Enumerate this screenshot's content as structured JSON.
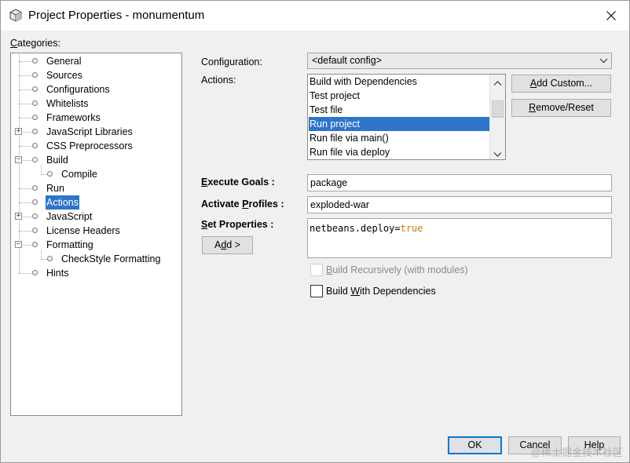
{
  "window": {
    "title": "Project Properties - monumentum",
    "icon": "netbeans-project-cube-icon"
  },
  "categories": {
    "label": "Categories:",
    "items": [
      {
        "label": "General"
      },
      {
        "label": "Sources"
      },
      {
        "label": "Configurations"
      },
      {
        "label": "Whitelists"
      },
      {
        "label": "Frameworks"
      },
      {
        "label": "JavaScript Libraries"
      },
      {
        "label": "CSS Preprocessors"
      },
      {
        "label": "Build"
      },
      {
        "label": "Compile"
      },
      {
        "label": "Run"
      },
      {
        "label": "Actions",
        "selected": true
      },
      {
        "label": "JavaScript"
      },
      {
        "label": "License Headers"
      },
      {
        "label": "Formatting"
      },
      {
        "label": "CheckStyle Formatting"
      },
      {
        "label": "Hints"
      }
    ]
  },
  "config": {
    "configuration_label": "Configuration:",
    "configuration_value": "<default config>",
    "actions_label": "Actions:",
    "actions": [
      "Build with Dependencies",
      "Test project",
      "Test file",
      "Run project",
      "Run file via main()",
      "Run file via deploy"
    ],
    "selected_action": "Run project",
    "add_custom_label": "Add Custom...",
    "remove_reset_label": "Remove/Reset",
    "execute_goals_label": "Execute Goals :",
    "execute_goals_value": "package",
    "activate_profiles_label": "Activate Profiles :",
    "activate_profiles_value": "exploded-war",
    "set_properties_label": "Set Properties :",
    "set_properties_key": "netbeans.deploy=",
    "set_properties_value": "true",
    "add_button_label": "Add >",
    "build_recursively_label": "Build Recursively (with modules)",
    "build_with_deps_label": "Build With Dependencies"
  },
  "footer": {
    "ok_label": "OK",
    "cancel_label": "Cancel",
    "help_label": "Help",
    "watermark": "@稀土掘金技术社区"
  },
  "colors": {
    "selection": "#2e74c9",
    "default_button_border": "#0078d7",
    "keyword": "#ce7b00"
  }
}
